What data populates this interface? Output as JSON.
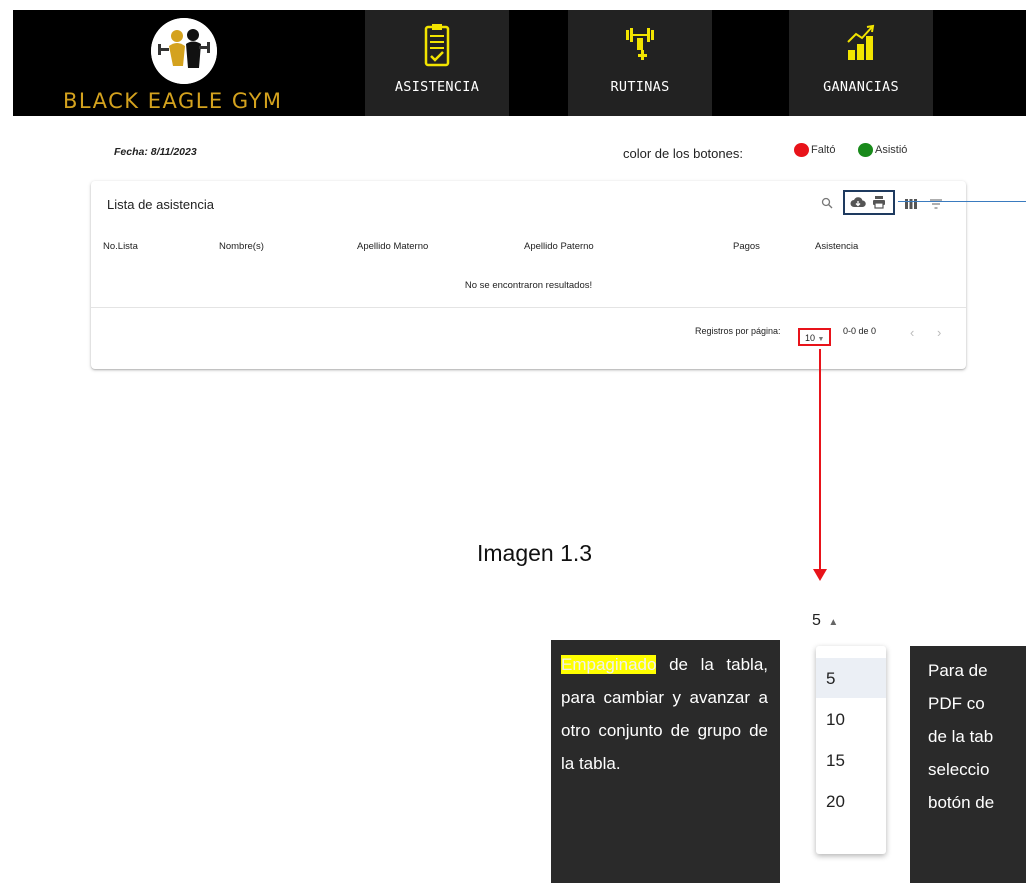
{
  "brand": {
    "name": "BLACK EAGLE GYM"
  },
  "nav": [
    {
      "label": "ASISTENCIA",
      "icon": "clipboard-check-icon"
    },
    {
      "label": "RUTINAS",
      "icon": "dumbbell-icon"
    },
    {
      "label": "GANANCIAS",
      "icon": "growth-chart-icon"
    }
  ],
  "header_info": {
    "fecha": "Fecha: 8/11/2023",
    "legend_title": "color de los botones:",
    "legend_falto": "Faltó",
    "legend_asistio": "Asistió"
  },
  "colors": {
    "falto": "#e8131a",
    "asistio": "#198a1b",
    "accent_gold": "#d4a21e",
    "nav_bg": "#222222"
  },
  "table": {
    "title": "Lista de asistencia",
    "toolbar_icons": [
      "search-icon",
      "cloud-download-icon",
      "print-icon",
      "view-columns-icon",
      "filter-icon"
    ],
    "columns": [
      "No.Lista",
      "Nombre(s)",
      "Apellido Materno",
      "Apellido Paterno",
      "Pagos",
      "Asistencia"
    ],
    "empty_message": "No se encontraron resultados!",
    "pagination": {
      "label": "Registros por página:",
      "selected": "10",
      "range": "0-0 de 0"
    }
  },
  "caption": "Imagen 1.3",
  "zoom_select": {
    "value": "5",
    "options": [
      "5",
      "10",
      "15",
      "20"
    ],
    "highlighted": "5"
  },
  "note_left": {
    "highlight": "Empaginado",
    "rest": " de la tabla, para cambiar y avanzar a otro conjunto de grupo de la tabla."
  },
  "note_right": {
    "lines": [
      "Para de",
      "PDF co",
      "de la tab",
      "seleccio",
      "botón de"
    ]
  }
}
